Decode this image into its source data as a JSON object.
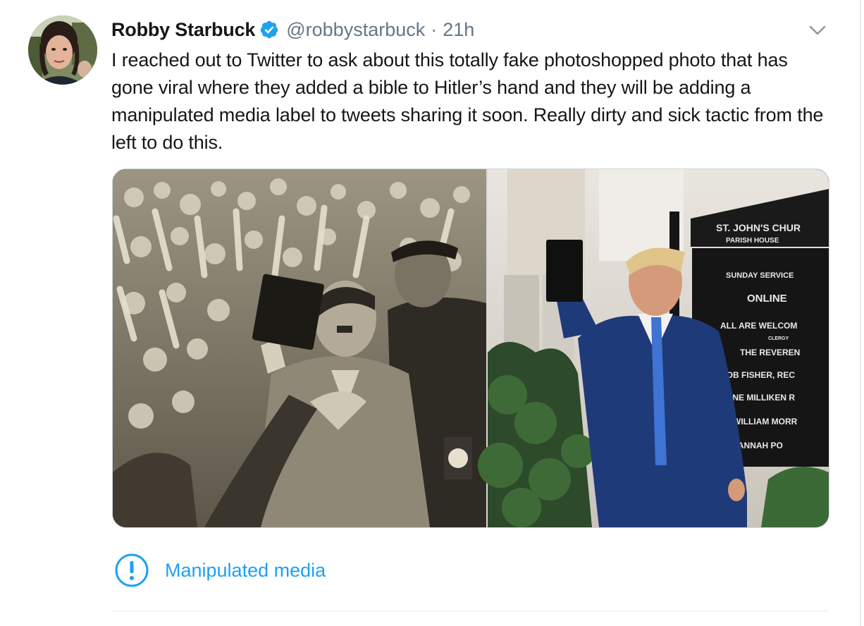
{
  "tweet": {
    "author": {
      "display_name": "Robby Starbuck",
      "handle": "@robbystarbuck",
      "verified": true,
      "avatar_icon": "profile-photo"
    },
    "separator": "·",
    "time": "21h",
    "text": "I reached out to Twitter to ask about this totally fake photoshopped photo that has gone viral where they added a bible to Hitler’s hand and they will be adding a manipulated media label to tweets sharing it soon. Really dirty and sick tactic from the left to do this.",
    "media": {
      "church_sign": {
        "line1": "ST. JOHN'S CHUR",
        "line2": "PARISH HOUSE",
        "line3": "SUNDAY SERVICE",
        "line4": "ONLINE",
        "line5": "ALL ARE WELCOM",
        "line6": "CLERGY",
        "line7": "THE REVEREN",
        "line8": "ROB FISHER, REC",
        "line9": "JANE MILLIKEN R",
        "line10": "WILLIAM MORR",
        "line11": "SAVANNAH PO"
      }
    },
    "label": {
      "text": "Manipulated media",
      "icon": "exclamation-circle-icon"
    }
  },
  "colors": {
    "text_primary": "#14171a",
    "text_secondary": "#657786",
    "link_blue": "#1da1f2",
    "verified_blue": "#1da1f2",
    "border": "#e6ecf0"
  }
}
